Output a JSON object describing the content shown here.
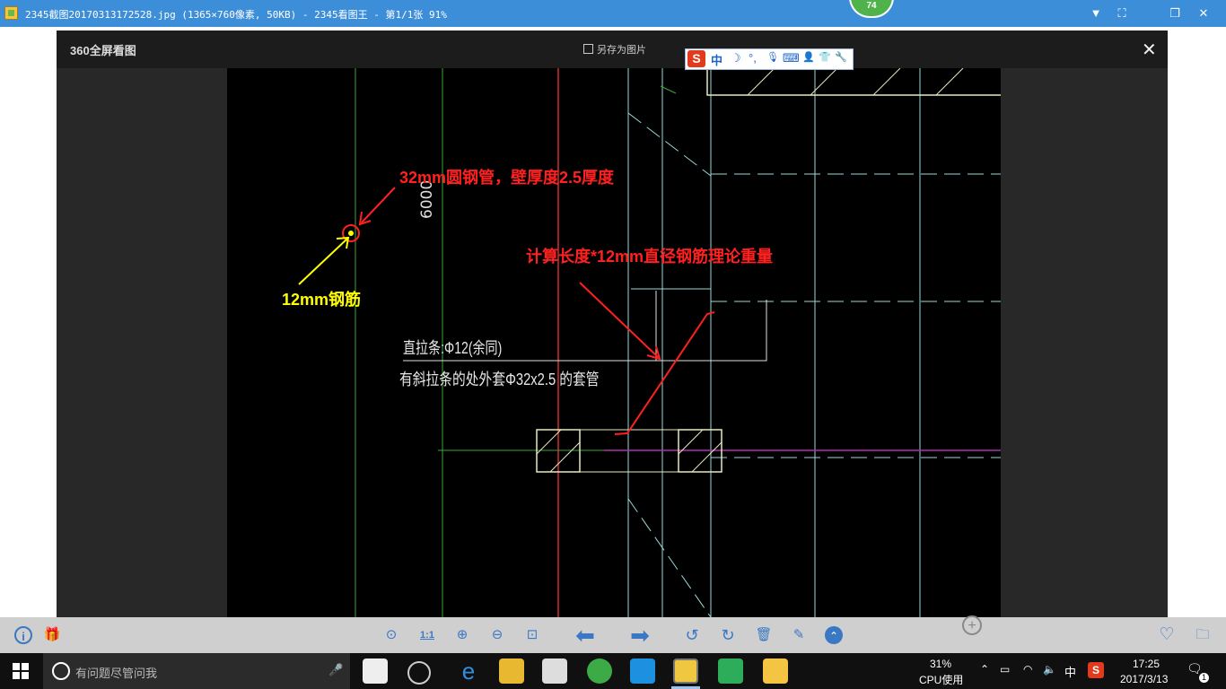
{
  "window": {
    "title": "2345截图20170313172528.jpg (1365×760像素, 50KB) - 2345看图王 - 第1/1张 91%",
    "badge": "74",
    "controls": {
      "menu": "▼",
      "fullscreen": "⛶",
      "restore": "❐",
      "close": "✕"
    }
  },
  "viewer": {
    "logo": "360全屏看图",
    "save_as": "另存为图片",
    "close": "✕"
  },
  "ime": {
    "logo": "S",
    "lang": "中",
    "moon": "☽",
    "punct": "°,",
    "mic": "🎙",
    "keyboard": "⌨",
    "user": "👤",
    "skin": "👕",
    "tools": "🔧"
  },
  "drawing": {
    "dim_text": "6000",
    "cad_note_1": "直拉条:Φ12(余同)",
    "cad_note_2": "有斜拉条的处外套Φ32x2.5 的套管",
    "annotation_pipe": "32mm圆钢管，壁厚度2.5厚度",
    "annotation_calc": "计算长度*12mm直径钢筋理论重量",
    "annotation_rebar": "12mm钢筋",
    "colors": {
      "red": "#ff2020",
      "yellow": "#ffff00",
      "cyan": "#9ad9d9",
      "green": "#3aa83a"
    }
  },
  "toolbar": {
    "info": "i",
    "gift": "🎁",
    "fit": "⊙",
    "one_to_one": "1:1",
    "zoom_in": "⊕",
    "zoom_out": "⊖",
    "actual": "⊡",
    "prev": "⬅",
    "next": "➡",
    "rotate_left": "↺",
    "rotate_right": "↻",
    "delete": "🗑",
    "edit": "✎",
    "more": "⌃",
    "favorite": "♡",
    "folder": "🗀"
  },
  "taskbar": {
    "search_placeholder": "有问题尽管问我",
    "cpu_percent": "31%",
    "cpu_label": "CPU使用",
    "ime_tray": "中",
    "time": "17:25",
    "date": "2017/3/13",
    "notification_count": "1"
  }
}
